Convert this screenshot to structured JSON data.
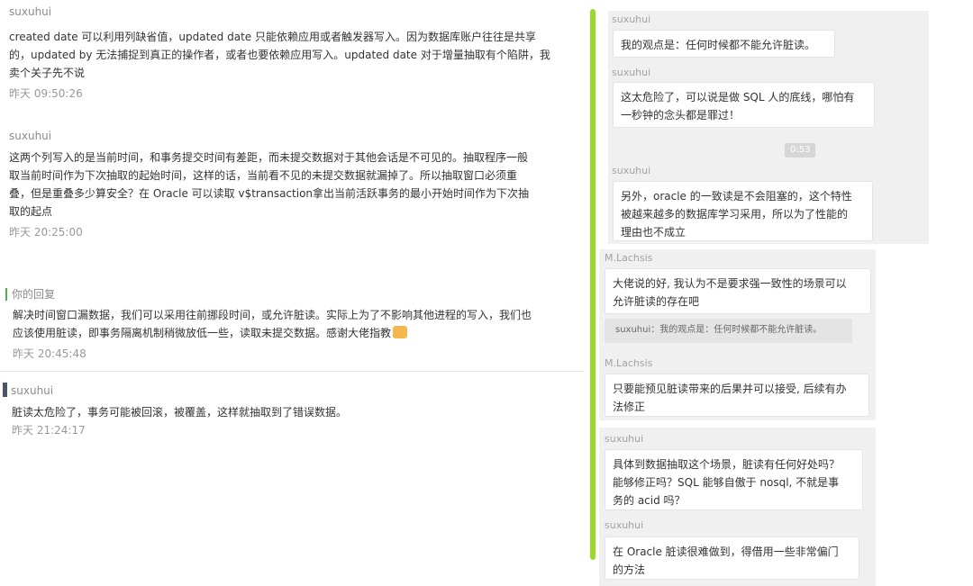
{
  "comments": [
    {
      "author": "suxuhui",
      "lines": [
        "created date 可以利用列缺省值，updated date 只能依赖应用或者触发器写入。因为数据库账户往往是共享",
        "的，updated by 无法捕捉到真正的操作者，或者也要依赖应用写入。updated date 对于增量抽取有个陷阱，我",
        "卖个关子先不说"
      ],
      "time": "昨天 09:50:26"
    },
    {
      "author": "suxuhui",
      "lines": [
        "这两个列写入的是当前时间，和事务提交时间有差距，而未提交数据对于其他会话是不可见的。抽取程序一般",
        "取当前时间作为下次抽取的起始时间，这样的话，当前看不见的未提交数据就漏掉了。所以抽取窗口必须重",
        "叠，但是重叠多少算安全？在 Oracle 可以读取 v$transaction拿出当前活跃事务的最小开始时间作为下次抽",
        "取的起点"
      ],
      "time": "昨天 20:25:00"
    },
    {
      "author": "你的回复",
      "lines": [
        "解决时间窗口漏数据，我们可以采用往前挪段时间，或允许脏读。实际上为了不影响其他进程的写入，我们也",
        "应该使用脏读，即事务隔离机制稍微放低一些，读取未提交数据。感谢大佬指教"
      ],
      "time": "昨天 20:45:48"
    },
    {
      "author": "suxuhui",
      "lines": [
        "脏读太危险了，事务可能被回滚，被覆盖，这样就抽取到了错误数据。"
      ],
      "time": "昨天 21:24:17"
    }
  ],
  "chat": {
    "messages": [
      {
        "user": "suxuhui",
        "lines": [
          "我的观点是：任何时候都不能允许脏读。"
        ]
      },
      {
        "user": "suxuhui",
        "lines": [
          "这太危险了，可以说是做 SQL 人的底线，哪怕有",
          "一秒钟的念头都是罪过！"
        ]
      },
      {
        "timestamp": "0:53"
      },
      {
        "user": "suxuhui",
        "lines": [
          "另外，oracle 的一致读是不会阻塞的，这个特性",
          "被越来越多的数据库学习采用，所以为了性能的",
          "理由也不成立"
        ]
      },
      {
        "user": "M.Lachsis",
        "lines": [
          "大佬说的好, 我认为不是要求强一致性的场景可以",
          "允许脏读的存在吧"
        ],
        "quote": "suxuhui：我的观点是：任何时候都不能允许脏读。"
      },
      {
        "user": "M.Lachsis",
        "lines": [
          "只要能预见脏读带来的后果并可以接受, 后续有办",
          "法修正"
        ]
      },
      {
        "user": "suxuhui",
        "lines": [
          "具体到数据抽取这个场景，脏读有任何好处吗？",
          "能够修正吗？SQL 能够自傲于 nosql, 不就是事",
          "务的 acid 吗？"
        ]
      },
      {
        "user": "suxuhui",
        "lines": [
          "在 Oracle 脏读很难做到，得借用一些非常偏门",
          "的方法"
        ]
      }
    ]
  },
  "colors": {
    "scroll_accent": "#9ed82b",
    "reply_marker": "#4caf50",
    "panel_bg": "#f0f0f0"
  },
  "icons": {
    "thumbs_up": "thumbs-up-icon",
    "avatar": "avatar-icon"
  }
}
